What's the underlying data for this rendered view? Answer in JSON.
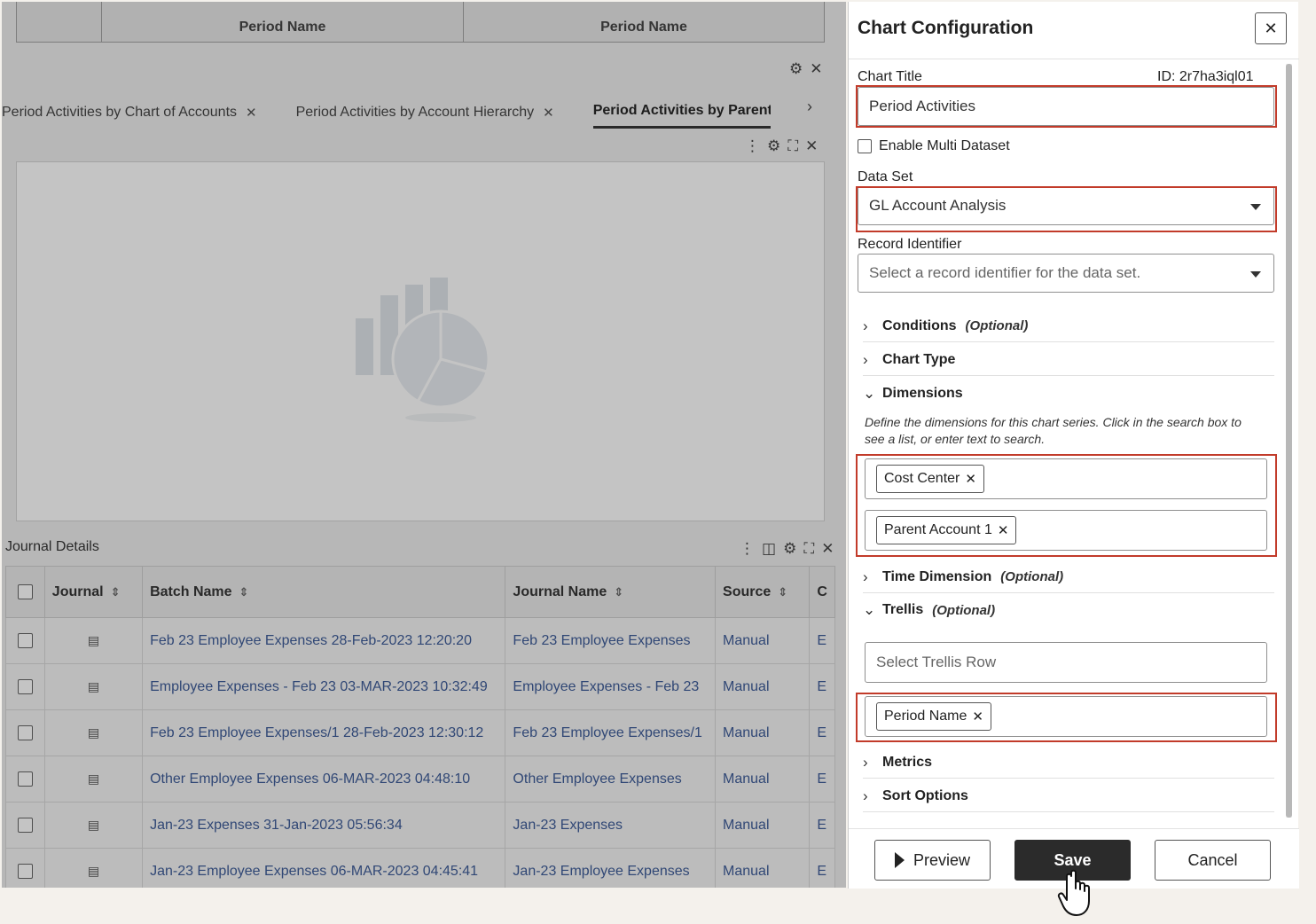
{
  "background": {
    "top_table": {
      "headers": [
        "",
        "Period Name",
        "Period Name"
      ]
    },
    "tabs": [
      {
        "label": "Period Activities by Chart of Accounts"
      },
      {
        "label": "Period Activities by Account Hierarchy"
      },
      {
        "label": "Period Activities by Parent"
      }
    ],
    "journal_details": {
      "title": "Journal Details",
      "columns": [
        "Journal",
        "Batch Name",
        "Journal Name",
        "Source",
        "C"
      ],
      "rows": [
        {
          "batch": "Feb 23 Employee Expenses 28-Feb-2023 12:20:20",
          "journal": "Feb 23 Employee Expenses",
          "source": "Manual",
          "c": "E"
        },
        {
          "batch": "Employee Expenses - Feb 23 03-MAR-2023 10:32:49",
          "journal": "Employee Expenses - Feb 23",
          "source": "Manual",
          "c": "E"
        },
        {
          "batch": "Feb 23 Employee Expenses/1 28-Feb-2023 12:30:12",
          "journal": "Feb 23 Employee Expenses/1",
          "source": "Manual",
          "c": "E"
        },
        {
          "batch": "Other Employee Expenses 06-MAR-2023 04:48:10",
          "journal": "Other Employee Expenses",
          "source": "Manual",
          "c": "E"
        },
        {
          "batch": "Jan-23 Expenses 31-Jan-2023 05:56:34",
          "journal": "Jan-23 Expenses",
          "source": "Manual",
          "c": "E"
        },
        {
          "batch": "Jan-23 Employee Expenses 06-MAR-2023 04:45:41",
          "journal": "Jan-23 Employee Expenses",
          "source": "Manual",
          "c": "E"
        }
      ]
    }
  },
  "panel": {
    "title": "Chart Configuration",
    "chart_title_label": "Chart Title",
    "id_label": "ID: 2r7ha3iql01",
    "chart_title_value": "Period Activities",
    "enable_multi_dataset": "Enable Multi Dataset",
    "data_set_label": "Data Set",
    "data_set_value": "GL Account Analysis",
    "record_identifier_label": "Record Identifier",
    "record_identifier_placeholder": "Select a record identifier for the data set.",
    "sections": {
      "conditions": "Conditions",
      "conditions_opt": "(Optional)",
      "chart_type": "Chart Type",
      "dimensions": "Dimensions",
      "time_dimension": "Time Dimension",
      "time_dimension_opt": "(Optional)",
      "trellis": "Trellis",
      "trellis_opt": "(Optional)",
      "metrics": "Metrics",
      "sort_options": "Sort Options"
    },
    "dimensions_desc": "Define the dimensions for this chart series. Click in the search box to see a list, or enter text to search.",
    "dimension_chips": [
      "Cost Center",
      "Parent Account 1"
    ],
    "trellis_row_placeholder": "Select Trellis Row",
    "trellis_column_chip": "Period Name",
    "buttons": {
      "preview": "Preview",
      "save": "Save",
      "cancel": "Cancel"
    }
  },
  "colors": {
    "highlight": "#c23b2a",
    "primary_button": "#2b2b2b",
    "link": "#2c4d8f"
  },
  "icons": [
    "gear-icon",
    "close-icon",
    "chevron-right-icon",
    "chevron-down-icon",
    "more-vertical-icon",
    "fullscreen-icon",
    "panel-icon",
    "sort-icon",
    "document-icon",
    "play-icon",
    "hand-cursor-icon",
    "chart-placeholder-icon"
  ]
}
